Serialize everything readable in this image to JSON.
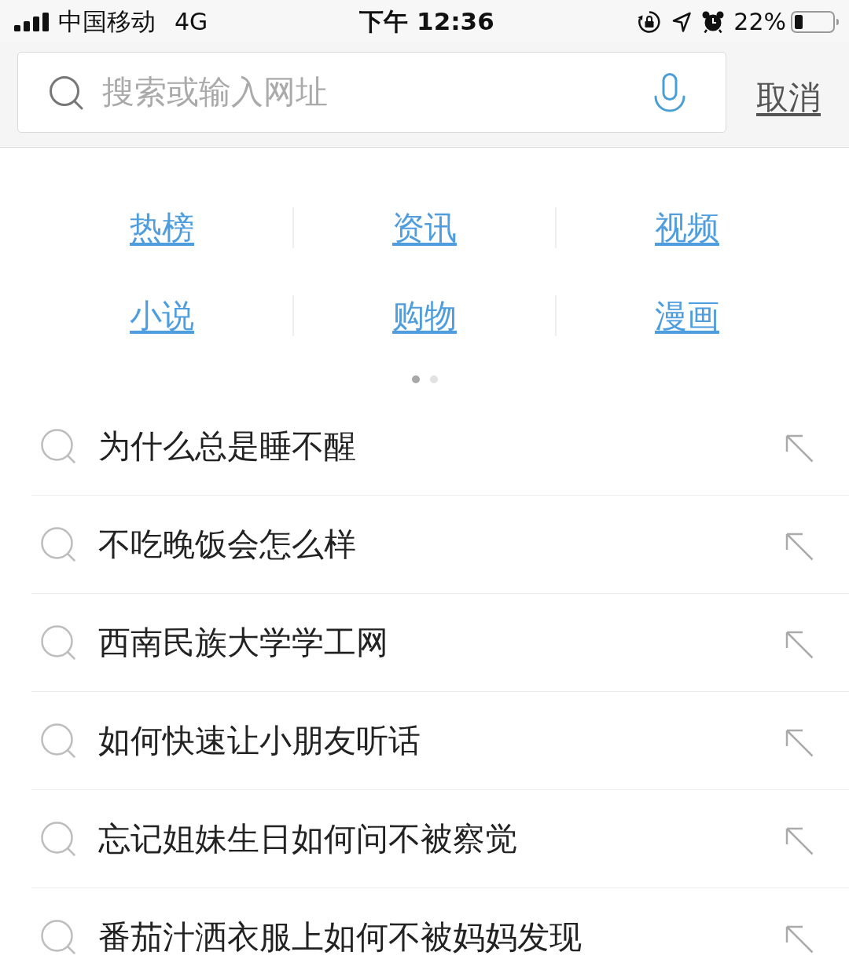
{
  "status_bar": {
    "carrier": "中国移动",
    "network": "4G",
    "time": "下午 12:36",
    "battery_percent": "22%"
  },
  "search_bar": {
    "placeholder": "搜索或输入网址",
    "cancel_button": "取消"
  },
  "quick_links": {
    "items": [
      {
        "label": "热榜"
      },
      {
        "label": "资讯"
      },
      {
        "label": "视频"
      },
      {
        "label": "小说"
      },
      {
        "label": "购物"
      },
      {
        "label": "漫画"
      }
    ],
    "pages": [
      {
        "selected": true
      },
      {
        "selected": false
      }
    ]
  },
  "suggestions": [
    {
      "text": "为什么总是睡不醒"
    },
    {
      "text": "不吃晚饭会怎么样"
    },
    {
      "text": "西南民族大学学工网"
    },
    {
      "text": "如何快速让小朋友听话"
    },
    {
      "text": "忘记姐妹生日如何问不被察觉"
    },
    {
      "text": "番茄汁洒衣服上如何不被妈妈发现"
    }
  ]
}
